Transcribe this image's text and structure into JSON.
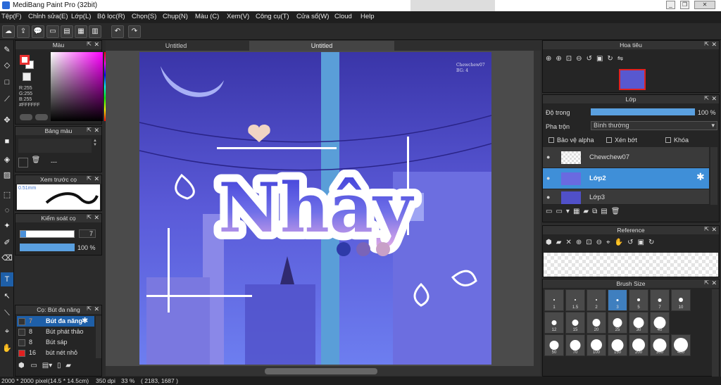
{
  "window": {
    "title": "MediBang Paint Pro (32bit)"
  },
  "menu": [
    "Tệp(F)",
    "Chỉnh sửa(E)",
    "Lớp(L)",
    "Bộ lọc(R)",
    "Chọn(S)",
    "Chụp(N)",
    "Màu (C)",
    "Xem(V)",
    "Công cụ(T)",
    "Cửa sổ(W)",
    "Cloud",
    "Help"
  ],
  "color_panel": {
    "title": "Màu",
    "r": "R:255",
    "g": "G:255",
    "b": "B:255",
    "hex": "#FFFFFF",
    "primary": "#e83030",
    "secondary": "#ffffff"
  },
  "palette_panel": {
    "title": "Bảng màu",
    "value": "---"
  },
  "preview_panel": {
    "title": "Xem trước cọ",
    "size": "0.51mm"
  },
  "brush_control": {
    "title": "Kiểm soát cọ",
    "size": "7",
    "opacity": "100 %"
  },
  "brush_list": {
    "title": "Cọ: Bút đa năng",
    "items": [
      {
        "size": "7",
        "name": "Bút đa năng",
        "selected": true,
        "color": "#333333"
      },
      {
        "size": "8",
        "name": "Bút phát thảo",
        "selected": false,
        "color": "#333333"
      },
      {
        "size": "8",
        "name": "Bút sáp",
        "selected": false,
        "color": "#333333"
      },
      {
        "size": "16",
        "name": "bút nét nhỏ",
        "selected": false,
        "color": "#e02020"
      }
    ]
  },
  "tabs": [
    "Untitled",
    "Untitled"
  ],
  "artwork": {
    "text": "Nhây",
    "signature_line1": "Chewchew07",
    "signature_line2": "BG: 4"
  },
  "navigator": {
    "title": "Hoa tiêu"
  },
  "layers": {
    "title": "Lớp",
    "opacity_label": "Độ trong",
    "opacity_value": "100 %",
    "blend_label": "Pha trộn",
    "blend_value": "Bình thường",
    "protect_alpha": "Bảo vệ alpha",
    "clipping": "Xén bớt",
    "lock": "Khóa",
    "items": [
      {
        "name": "Chewchew07",
        "selected": false
      },
      {
        "name": "Lớp2",
        "selected": true
      },
      {
        "name": "Lớp3",
        "selected": false
      }
    ]
  },
  "reference": {
    "title": "Reference"
  },
  "brush_size": {
    "title": "Brush Size",
    "row1": [
      "1",
      "1.5",
      "2",
      "3",
      "5",
      "7",
      "10"
    ],
    "row2": [
      "12",
      "15",
      "20",
      "25",
      "30",
      "40"
    ],
    "row3": [
      "50",
      "70",
      "100",
      "150",
      "200",
      "300",
      "400"
    ]
  },
  "status": {
    "dimensions": "2000 * 2000 pixel",
    "physical": "(14.5 * 14.5cm)",
    "dpi": "350 dpi",
    "zoom": "33 %",
    "coords": "( 2183, 1687 )"
  }
}
